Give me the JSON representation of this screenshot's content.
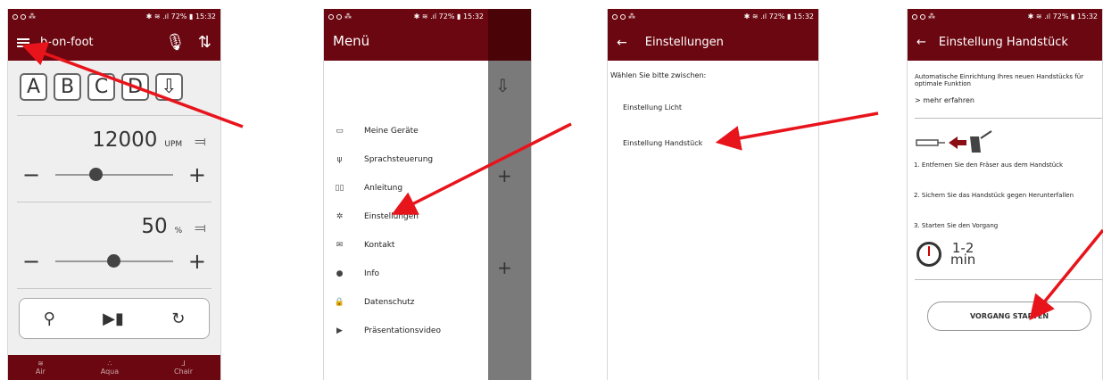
{
  "status": {
    "battery": "72%",
    "time": "15:32"
  },
  "screen1": {
    "app_title": "b-on-foot",
    "presets": [
      "A",
      "B",
      "C",
      "D"
    ],
    "speed": {
      "value": "12000",
      "unit": "UPM"
    },
    "spray": {
      "value": "50",
      "unit": "%"
    },
    "nav": [
      "Air",
      "Aqua",
      "Chair"
    ]
  },
  "screen2": {
    "menu_title": "Menü",
    "items": [
      {
        "label": "Meine Geräte",
        "icon": "devices-icon"
      },
      {
        "label": "Sprachsteuerung",
        "icon": "microphone-icon"
      },
      {
        "label": "Anleitung",
        "icon": "book-icon"
      },
      {
        "label": "Einstellungen",
        "icon": "gear-icon"
      },
      {
        "label": "Kontakt",
        "icon": "mail-icon"
      },
      {
        "label": "Info",
        "icon": "info-icon"
      },
      {
        "label": "Datenschutz",
        "icon": "lock-icon"
      },
      {
        "label": "Präsentationsvideo",
        "icon": "play-icon"
      }
    ]
  },
  "screen3": {
    "title": "Einstellungen",
    "intro": "Wählen Sie bitte zwischen:",
    "options": [
      "Einstellung Licht",
      "Einstellung Handstück"
    ]
  },
  "screen4": {
    "title": "Einstellung Handstück",
    "description": "Automatische Einrichtung Ihres neuen Handstücks für optimale Funktion",
    "more_link": "> mehr erfahren",
    "steps": [
      "1. Entfernen Sie den Fräser aus dem Handstück",
      "2. Sichern Sie das Handstück gegen Herunterfallen",
      "3. Starten Sie den Vorgang"
    ],
    "duration": {
      "value": "1-2",
      "unit": "min"
    },
    "button": "VORGANG STARTEN"
  },
  "colors": {
    "brand": "#6b0710",
    "arrow": "#e8141c"
  }
}
